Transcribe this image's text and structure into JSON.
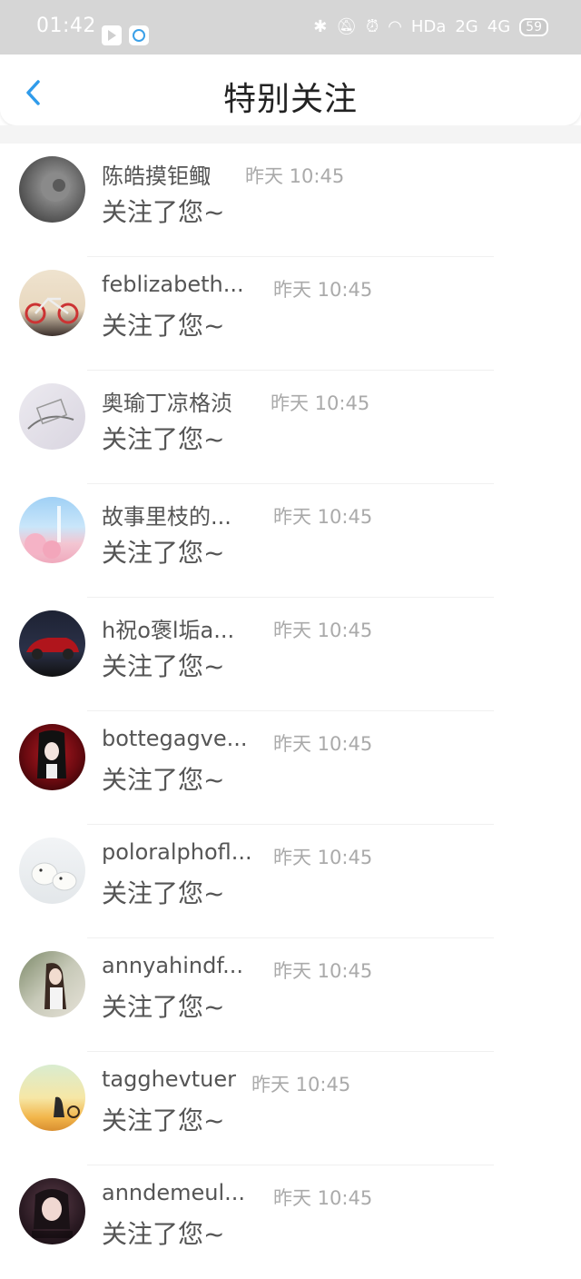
{
  "status_bar": {
    "time": "01:42",
    "indicators": [
      "bluetooth-icon",
      "mute-icon",
      "alarm-icon",
      "wifi-icon",
      "HD",
      "2G",
      "4G"
    ],
    "hd_label": "HDa",
    "net1": "2G",
    "net2": "4G",
    "battery": "59"
  },
  "header": {
    "title": "特别关注"
  },
  "list": {
    "items": [
      {
        "name": "陈皓摸钜鲰",
        "time": "昨天 10:45",
        "message": "关注了您~"
      },
      {
        "name": "feblizabeth...",
        "time": "昨天 10:45",
        "message": "关注了您~"
      },
      {
        "name": "奥瑜丁凉格浈",
        "time": "昨天 10:45",
        "message": "关注了您~"
      },
      {
        "name": "故事里枝的...",
        "time": "昨天 10:45",
        "message": "关注了您~"
      },
      {
        "name": "h祝o褒l垢a...",
        "time": "昨天 10:45",
        "message": "关注了您~"
      },
      {
        "name": "bottegagve...",
        "time": "昨天 10:45",
        "message": "关注了您~"
      },
      {
        "name": "poloralphofl...",
        "time": "昨天 10:45",
        "message": "关注了您~"
      },
      {
        "name": "annyahindf...",
        "time": "昨天 10:45",
        "message": "关注了您~"
      },
      {
        "name": "tagghevtuer",
        "time": "昨天 10:45",
        "message": "关注了您~"
      },
      {
        "name": "anndemeul...",
        "time": "昨天 10:45",
        "message": "关注了您~"
      }
    ]
  },
  "colors": {
    "accent": "#2f9bea",
    "status_bar_bg": "#d6d6d6",
    "text": "#555555",
    "muted": "#aaaaaa"
  }
}
